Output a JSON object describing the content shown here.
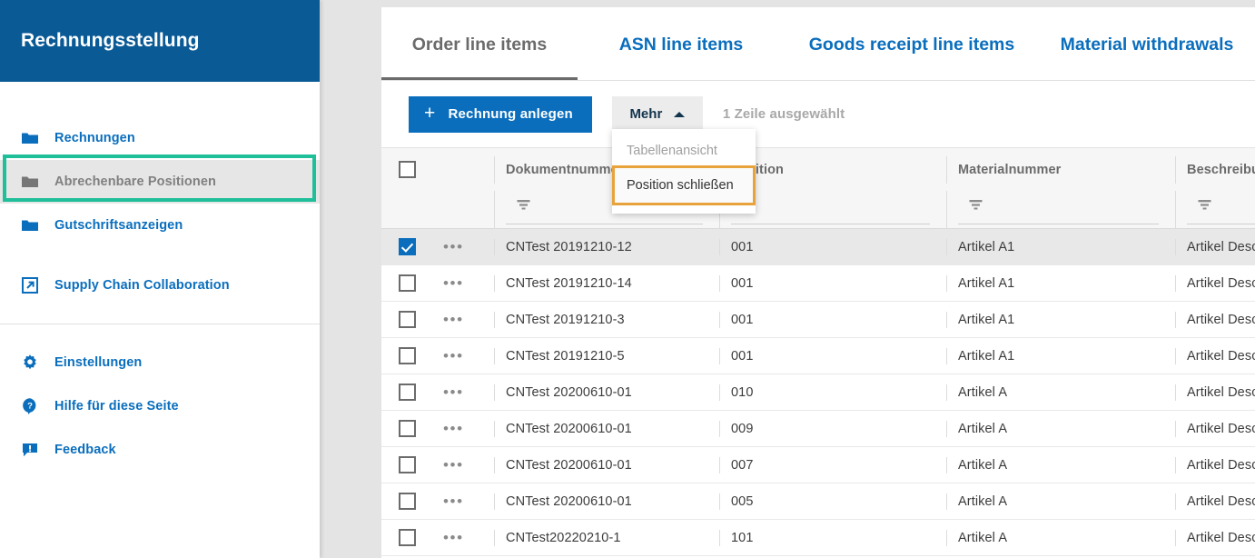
{
  "sidebar": {
    "title": "Rechnungsstellung",
    "items": [
      {
        "label": "Rechnungen",
        "icon": "folder-icon",
        "selected": false
      },
      {
        "label": "Abrechenbare Positionen",
        "icon": "folder-icon",
        "selected": true
      },
      {
        "label": "Gutschriftsanzeigen",
        "icon": "folder-icon",
        "selected": false
      }
    ],
    "link": {
      "label": "Supply Chain Collaboration",
      "icon": "external-link-icon"
    },
    "footer_items": [
      {
        "label": "Einstellungen",
        "icon": "gear-icon"
      },
      {
        "label": "Hilfe für diese Seite",
        "icon": "help-circle-icon"
      },
      {
        "label": "Feedback",
        "icon": "feedback-icon"
      }
    ],
    "highlight_color": "#1fbf9a",
    "header_color": "#0a5a96",
    "link_color": "#0a6ebd"
  },
  "tabs": [
    {
      "label": "Order line items",
      "active": true
    },
    {
      "label": "ASN line items",
      "active": false
    },
    {
      "label": "Goods receipt line items",
      "active": false
    },
    {
      "label": "Material withdrawals",
      "active": false
    }
  ],
  "toolbar": {
    "create_label": "Rechnung anlegen",
    "create_icon": "plus-icon",
    "more_label": "Mehr",
    "more_icon": "chevron-up-icon",
    "selection_status": "1 Zeile ausgewählt"
  },
  "dropdown": {
    "items": [
      {
        "label": "Tabellenansicht",
        "enabled": false,
        "focused": false
      },
      {
        "label": "Position schließen",
        "enabled": true,
        "focused": true
      }
    ],
    "focus_color": "#e8a33d"
  },
  "table": {
    "columns": [
      {
        "key": "doc",
        "label": "Dokumentnummer"
      },
      {
        "key": "pos",
        "label": "Position"
      },
      {
        "key": "mat",
        "label": "Materialnummer"
      },
      {
        "key": "desc",
        "label": "Beschreibung"
      }
    ],
    "filter_icon": "filter-icon",
    "rows": [
      {
        "selected": true,
        "doc": "CNTest 20191210-12",
        "pos": "001",
        "mat": "Artikel A1",
        "desc": "Artikel Desc"
      },
      {
        "selected": false,
        "doc": "CNTest 20191210-14",
        "pos": "001",
        "mat": "Artikel A1",
        "desc": "Artikel Desc"
      },
      {
        "selected": false,
        "doc": "CNTest 20191210-3",
        "pos": "001",
        "mat": "Artikel A1",
        "desc": "Artikel Desc"
      },
      {
        "selected": false,
        "doc": "CNTest 20191210-5",
        "pos": "001",
        "mat": "Artikel A1",
        "desc": "Artikel Desc"
      },
      {
        "selected": false,
        "doc": "CNTest 20200610-01",
        "pos": "010",
        "mat": "Artikel A",
        "desc": "Artikel Desc"
      },
      {
        "selected": false,
        "doc": "CNTest 20200610-01",
        "pos": "009",
        "mat": "Artikel A",
        "desc": "Artikel Desc"
      },
      {
        "selected": false,
        "doc": "CNTest 20200610-01",
        "pos": "007",
        "mat": "Artikel A",
        "desc": "Artikel Desc"
      },
      {
        "selected": false,
        "doc": "CNTest 20200610-01",
        "pos": "005",
        "mat": "Artikel A",
        "desc": "Artikel Desc"
      },
      {
        "selected": false,
        "doc": "CNTest20220210-1",
        "pos": "101",
        "mat": "Artikel A",
        "desc": "Artikel Desc"
      }
    ],
    "row_menu_icon": "ellipsis-icon"
  }
}
